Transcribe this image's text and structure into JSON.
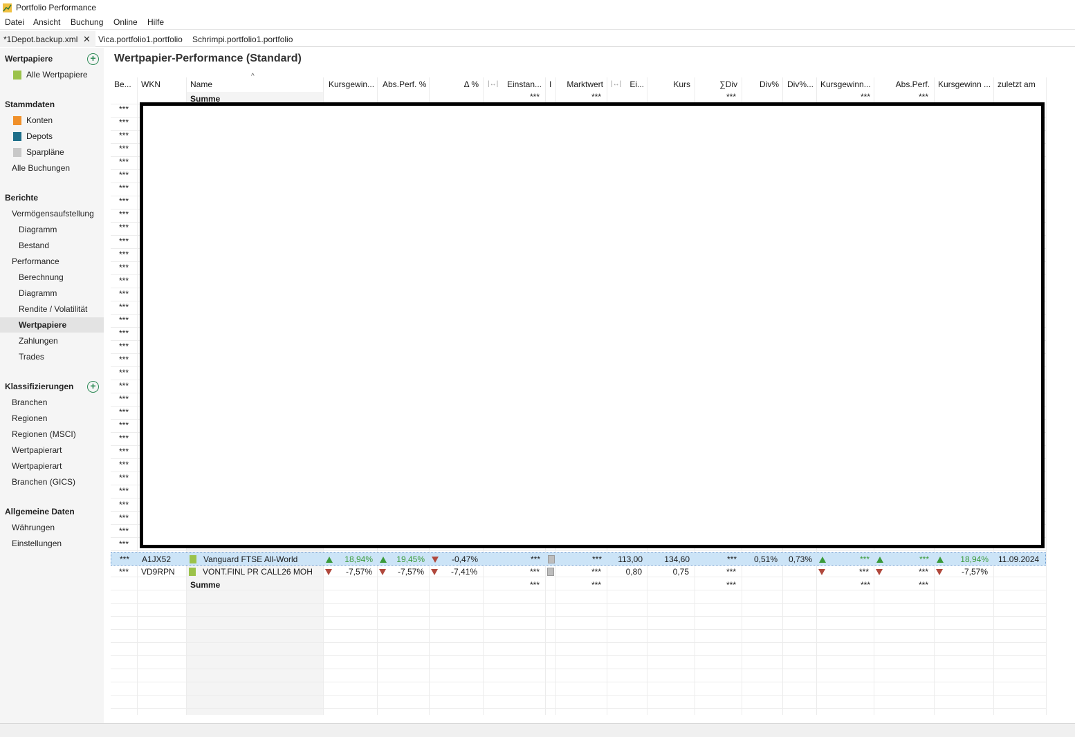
{
  "app": {
    "title": "Portfolio Performance"
  },
  "menu": [
    "Datei",
    "Ansicht",
    "Buchung",
    "Online",
    "Hilfe"
  ],
  "tabs": [
    {
      "label": "*1Depot.backup.xml"
    },
    {
      "label": "Vica.portfolio1.portfolio"
    },
    {
      "label": "Schrimpi.portfolio1.portfolio"
    }
  ],
  "sidebar": {
    "sec_wertpapiere": "Wertpapiere",
    "alle_wertpapiere": "Alle Wertpapiere",
    "sec_stammdaten": "Stammdaten",
    "konten": "Konten",
    "depots": "Depots",
    "sparplaene": "Sparpläne",
    "alle_buchungen": "Alle Buchungen",
    "sec_berichte": "Berichte",
    "vermoegensaufstellung": "Vermögensaufstellung",
    "diagramm1": "Diagramm",
    "bestand": "Bestand",
    "performance": "Performance",
    "berechnung": "Berechnung",
    "diagramm2": "Diagramm",
    "rendite": "Rendite / Volatilität",
    "wertpapiere": "Wertpapiere",
    "zahlungen": "Zahlungen",
    "trades": "Trades",
    "sec_klassifizierungen": "Klassifizierungen",
    "branchen": "Branchen",
    "regionen": "Regionen",
    "regionen_msci": "Regionen (MSCI)",
    "wertpapierart1": "Wertpapierart",
    "wertpapierart2": "Wertpapierart",
    "branchen_gics": "Branchen (GICS)",
    "sec_allgemein": "Allgemeine Daten",
    "waehrungen": "Währungen",
    "einstellungen": "Einstellungen"
  },
  "main": {
    "title": "Wertpapier-Performance (Standard)",
    "columns": {
      "be": "Be...",
      "wkn": "WKN",
      "name": "Name",
      "kursgewinn": "Kursgewin...",
      "absperf": "Abs.Perf. %",
      "delta": "Δ %",
      "einstand": "Einstan...",
      "note": "I",
      "marktwert": "Marktwert",
      "ei": "Ei...",
      "kurs": "Kurs",
      "sumdiv": "∑Div",
      "divpct": "Div%",
      "divpct2": "Div%...",
      "kursgewinn2": "Kursgewinn...",
      "absperf2": "Abs.Perf.",
      "kursgewinn3": "Kursgewinn ...",
      "zuletzt": "zuletzt am"
    },
    "top_summe": {
      "name": "Summe",
      "einstand": "***",
      "marktwert": "***",
      "sumdiv": "***",
      "kg2": "***",
      "ap2": "***"
    },
    "masked": "***",
    "rows": [
      {
        "be": "***",
        "wkn": "A1JX52",
        "name": "Vanguard FTSE All-World",
        "kursgewinn": "18,94%",
        "absperf": "19,45%",
        "delta": "-0,47%",
        "einstand": "***",
        "marktwert": "***",
        "ei": "113,00",
        "kurs": "134,60",
        "sumdiv": "***",
        "divpct": "0,51%",
        "divpct2": "0,73%",
        "kg2": "***",
        "ap2": "***",
        "kg3": "18,94%",
        "zuletzt": "11.09.2024"
      },
      {
        "be": "***",
        "wkn": "VD9RPN",
        "name": "VONT.FINL PR CALL26 MOH",
        "kursgewinn": "-7,57%",
        "absperf": "-7,57%",
        "delta": "-7,41%",
        "einstand": "***",
        "marktwert": "***",
        "ei": "0,80",
        "kurs": "0,75",
        "sumdiv": "***",
        "divpct": "",
        "divpct2": "",
        "kg2": "***",
        "ap2": "***",
        "kg3": "-7,57%",
        "zuletzt": ""
      }
    ],
    "summe": {
      "name": "Summe",
      "einstand": "***",
      "marktwert": "***",
      "sumdiv": "***",
      "kg2": "***",
      "ap2": "***"
    }
  },
  "colors": {
    "accent_green": "#3a9a3a",
    "down_red": "#b0483c",
    "selection": "#cce4f7"
  }
}
